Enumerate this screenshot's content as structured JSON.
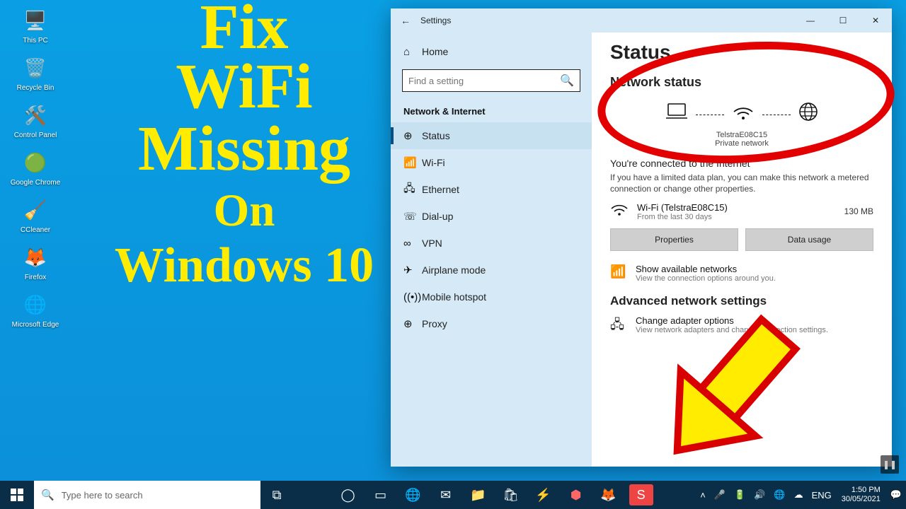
{
  "desktop": [
    {
      "name": "this-pc",
      "label": "This PC",
      "icon": "🖥️"
    },
    {
      "name": "recycle-bin",
      "label": "Recycle Bin",
      "icon": "🗑️"
    },
    {
      "name": "control-panel",
      "label": "Control Panel",
      "icon": "🛠️"
    },
    {
      "name": "google-chrome",
      "label": "Google Chrome",
      "icon": "🟢"
    },
    {
      "name": "ccleaner",
      "label": "CCleaner",
      "icon": "🧹"
    },
    {
      "name": "firefox",
      "label": "Firefox",
      "icon": "🦊"
    },
    {
      "name": "microsoft-edge",
      "label": "Microsoft Edge",
      "icon": "🌐"
    }
  ],
  "overlay": {
    "l1": "Fix",
    "l2": "WiFi",
    "l3": "Missing",
    "l4": "On",
    "l5": "Windows 10"
  },
  "settings": {
    "title": "Settings",
    "home": "Home",
    "search_placeholder": "Find a setting",
    "section": "Network & Internet",
    "nav": [
      {
        "name": "status",
        "label": "Status",
        "icon": "⊕",
        "sel": true
      },
      {
        "name": "wifi",
        "label": "Wi-Fi",
        "icon": "📶"
      },
      {
        "name": "ethernet",
        "label": "Ethernet",
        "icon": "🖧"
      },
      {
        "name": "dialup",
        "label": "Dial-up",
        "icon": "☏"
      },
      {
        "name": "vpn",
        "label": "VPN",
        "icon": "∞"
      },
      {
        "name": "airplane",
        "label": "Airplane mode",
        "icon": "✈"
      },
      {
        "name": "hotspot",
        "label": "Mobile hotspot",
        "icon": "((•))"
      },
      {
        "name": "proxy",
        "label": "Proxy",
        "icon": "⊕"
      }
    ],
    "content": {
      "h1": "Status",
      "h2": "Network status",
      "ssid": "TelstraE08C15",
      "net_type": "Private network",
      "connected_title": "You're connected to the Internet",
      "connected_desc": "If you have a limited data plan, you can make this network a metered connection or change other properties.",
      "usage_name": "Wi-Fi (TelstraE08C15)",
      "usage_sub": "From the last 30 days",
      "usage_size": "130 MB",
      "btn_props": "Properties",
      "btn_usage": "Data usage",
      "avail_title": "Show available networks",
      "avail_sub": "View the connection options around you.",
      "adv_head": "Advanced network settings",
      "adapter_title": "Change adapter options",
      "adapter_sub": "View network adapters and change connection settings."
    }
  },
  "taskbar": {
    "search": "Type here to search",
    "lang": "ENG",
    "time": "1:50 PM",
    "date": "30/05/2021"
  }
}
